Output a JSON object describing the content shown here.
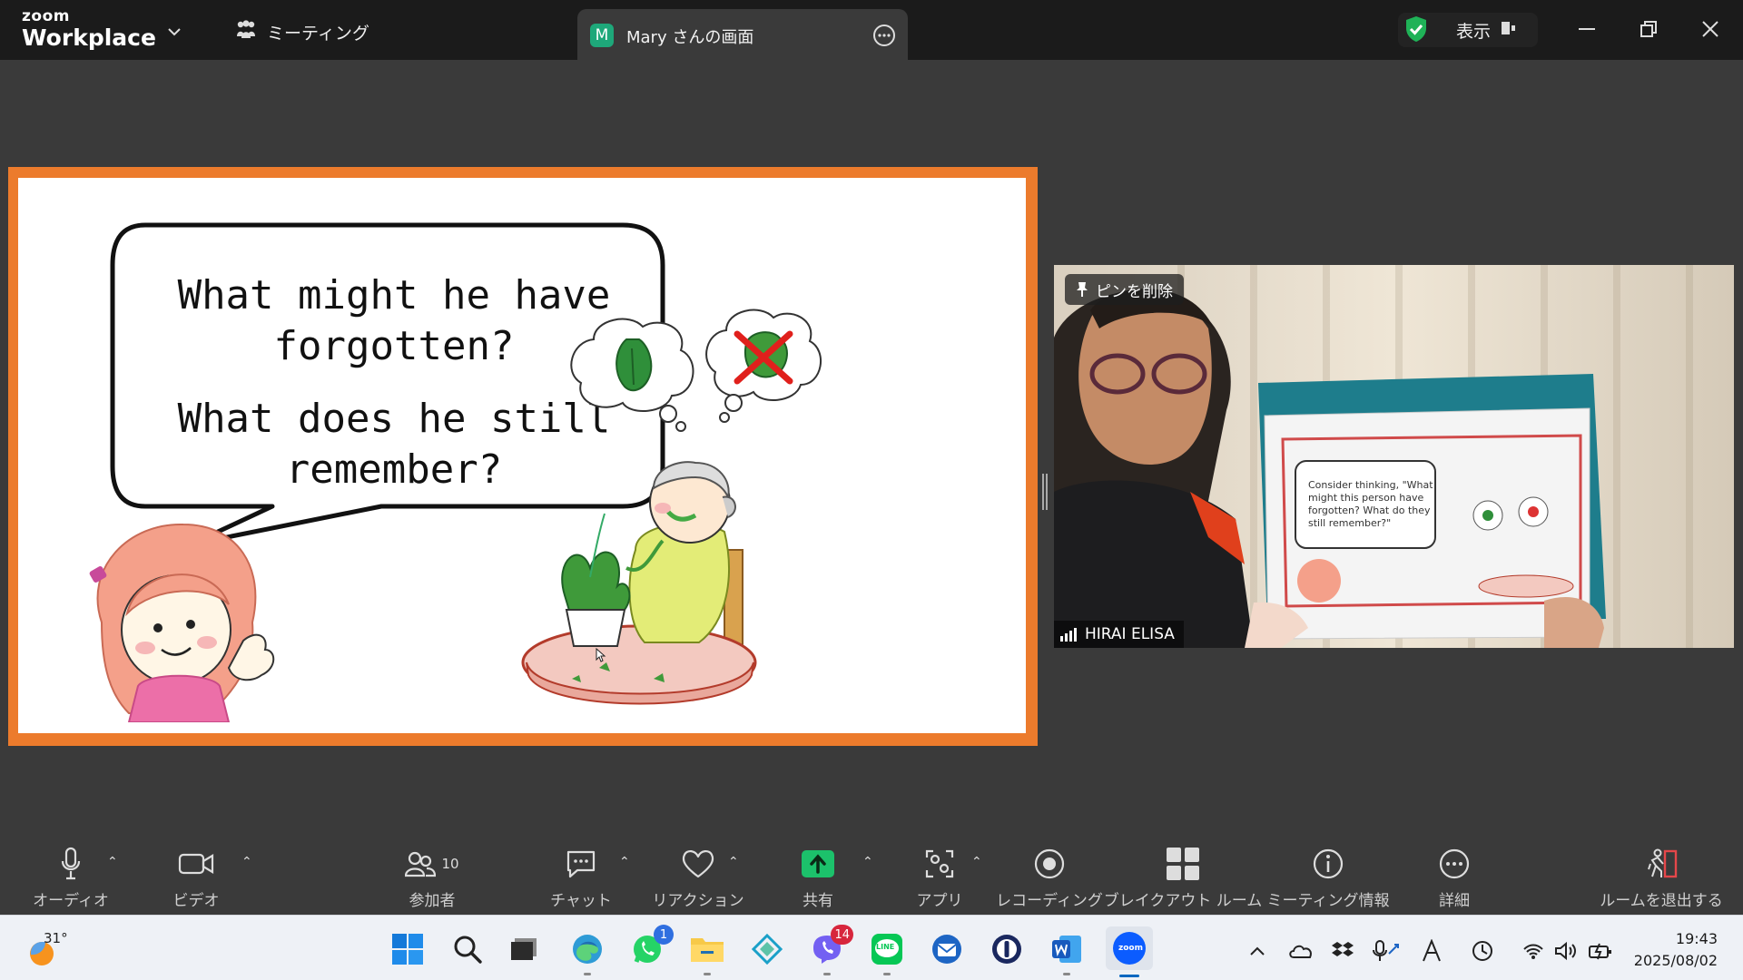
{
  "window": {
    "brand_small": "zoom",
    "brand_large": "Workplace",
    "meeting_label": "ミーティング",
    "tab_avatar": "M",
    "tab_label": "Mary さんの画面",
    "view_label": "表示",
    "accent": "#1ea87a"
  },
  "slide": {
    "question_1": "What might he have forgotten?",
    "question_2": "What does he still remember?",
    "frame_color": "#ec7b2c"
  },
  "video": {
    "pin_label": "ピンを削除",
    "participant_name": "HIRAI ELISA",
    "held_card_text": "Consider thinking, \"What might this person have forgotten? What do they still remember?\""
  },
  "toolbar": {
    "audio": "オーディオ",
    "video": "ビデオ",
    "participants": "参加者",
    "participants_count": "10",
    "chat": "チャット",
    "reactions": "リアクション",
    "share": "共有",
    "apps": "アプリ",
    "recording": "レコーディング",
    "breakout": "ブレイクアウト ルーム",
    "meeting_info": "ミーティング情報",
    "more": "詳細",
    "leave": "ルームを退出する"
  },
  "taskbar": {
    "weather_temp": "31°",
    "whatsapp_badge": "1",
    "viber_badge": "14",
    "line_label": "LINE",
    "zoom_label": "zoom",
    "time": "19:43",
    "date": "2025/08/02"
  }
}
